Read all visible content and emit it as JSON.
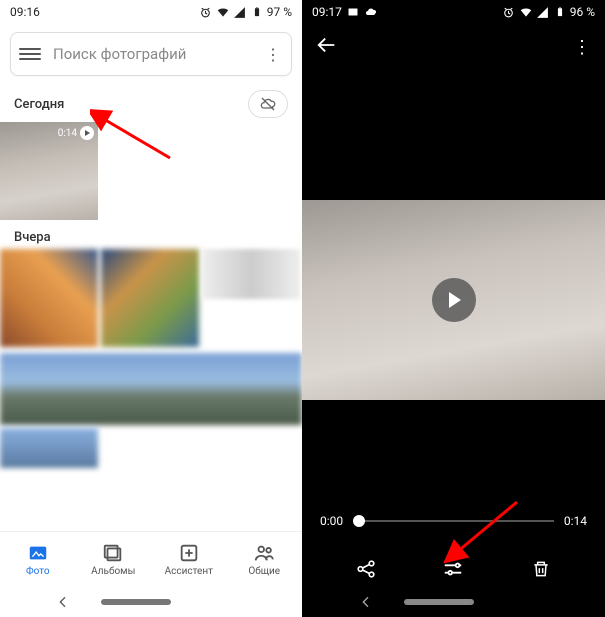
{
  "left": {
    "status": {
      "time": "09:16",
      "battery": "97 %"
    },
    "search": {
      "placeholder": "Поиск фотографий"
    },
    "sections": {
      "today": {
        "title": "Сегодня",
        "video_badge_duration": "0:14"
      },
      "yesterday": {
        "title": "Вчера"
      }
    },
    "nav": {
      "photos": "Фото",
      "albums": "Альбомы",
      "assistant": "Ассистент",
      "sharing": "Общие"
    }
  },
  "right": {
    "status": {
      "time": "09:17",
      "battery": "96 %"
    },
    "scrubber": {
      "current": "0:00",
      "duration": "0:14"
    }
  },
  "colors": {
    "accent": "#1a73e8",
    "arrow": "#ff0000"
  }
}
